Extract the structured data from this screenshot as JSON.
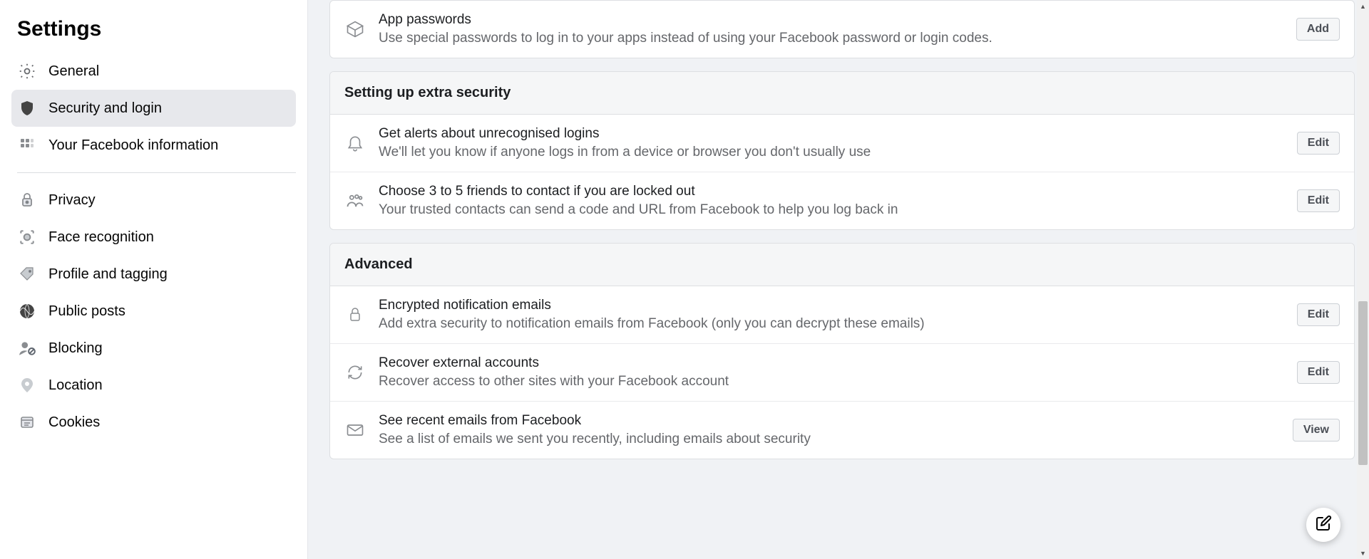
{
  "sidebar": {
    "title": "Settings",
    "group1": [
      {
        "label": "General",
        "icon": "gear-icon"
      },
      {
        "label": "Security and login",
        "icon": "shield-icon",
        "active": true
      },
      {
        "label": "Your Facebook information",
        "icon": "grid-icon"
      }
    ],
    "group2": [
      {
        "label": "Privacy",
        "icon": "lock-privacy-icon"
      },
      {
        "label": "Face recognition",
        "icon": "face-icon"
      },
      {
        "label": "Profile and tagging",
        "icon": "tag-icon"
      },
      {
        "label": "Public posts",
        "icon": "globe-icon"
      },
      {
        "label": "Blocking",
        "icon": "block-user-icon"
      },
      {
        "label": "Location",
        "icon": "location-pin-icon"
      },
      {
        "label": "Cookies",
        "icon": "cookies-icon"
      }
    ]
  },
  "top": {
    "title": "App passwords",
    "desc": "Use special passwords to log in to your apps instead of using your Facebook password or login codes.",
    "btn": "Add"
  },
  "sections": [
    {
      "header": "Setting up extra security",
      "rows": [
        {
          "icon": "bell-icon",
          "title": "Get alerts about unrecognised logins",
          "desc": "We'll let you know if anyone logs in from a device or browser you don't usually use",
          "btn": "Edit"
        },
        {
          "icon": "friends-icon",
          "title": "Choose 3 to 5 friends to contact if you are locked out",
          "desc": "Your trusted contacts can send a code and URL from Facebook to help you log back in",
          "btn": "Edit"
        }
      ]
    },
    {
      "header": "Advanced",
      "rows": [
        {
          "icon": "lock-icon",
          "title": "Encrypted notification emails",
          "desc": "Add extra security to notification emails from Facebook (only you can decrypt these emails)",
          "btn": "Edit"
        },
        {
          "icon": "refresh-icon",
          "title": "Recover external accounts",
          "desc": "Recover access to other sites with your Facebook account",
          "btn": "Edit"
        },
        {
          "icon": "envelope-icon",
          "title": "See recent emails from Facebook",
          "desc": "See a list of emails we sent you recently, including emails about security",
          "btn": "View"
        }
      ]
    }
  ]
}
